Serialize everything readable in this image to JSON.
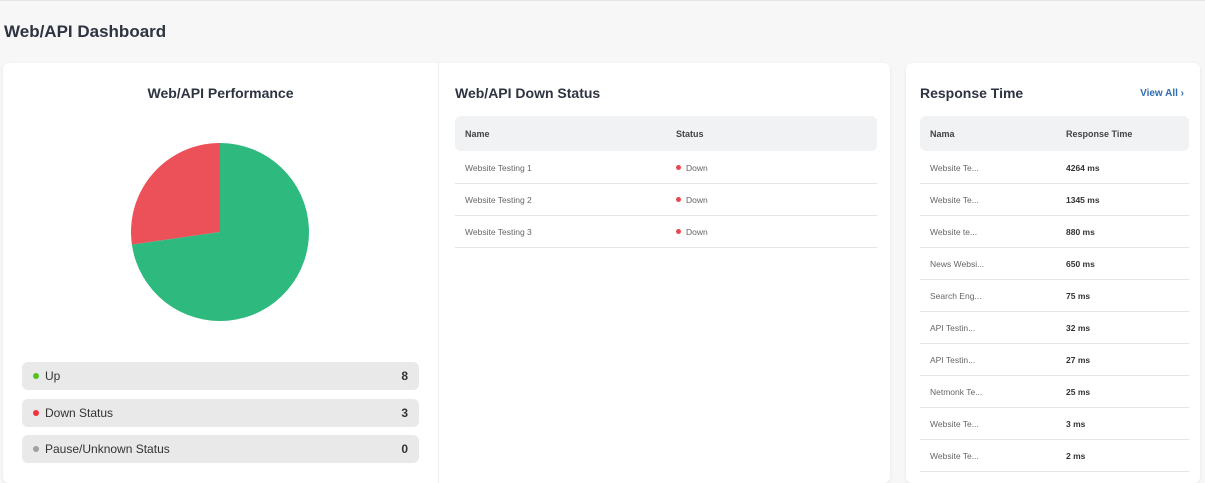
{
  "page_title": "Web/API Dashboard",
  "performance": {
    "title": "Web/API Performance",
    "colors": {
      "up": "#2eb97e",
      "down": "#ec5058"
    },
    "legend": [
      {
        "label": "Up",
        "value": "8",
        "color": "#52c41a"
      },
      {
        "label": "Down Status",
        "value": "3",
        "color": "#f5313f"
      },
      {
        "label": "Pause/Unknown Status",
        "value": "0",
        "color": "#a0a0a0"
      }
    ]
  },
  "down_status": {
    "title": "Web/API Down Status",
    "columns": [
      "Name",
      "Status"
    ],
    "rows": [
      {
        "name": "Website Testing 1",
        "status": "Down"
      },
      {
        "name": "Website Testing 2",
        "status": "Down"
      },
      {
        "name": "Website Testing 3",
        "status": "Down"
      }
    ]
  },
  "response": {
    "title": "Response Time",
    "view_all": "View All",
    "columns": [
      "Nama",
      "Response Time"
    ],
    "rows": [
      {
        "name": "Website Te...",
        "time": "4264 ms"
      },
      {
        "name": "Website Te...",
        "time": "1345 ms"
      },
      {
        "name": "Website te...",
        "time": "880 ms"
      },
      {
        "name": "News Websi...",
        "time": "650 ms"
      },
      {
        "name": "Search Eng...",
        "time": "75 ms"
      },
      {
        "name": "API Testin...",
        "time": "32 ms"
      },
      {
        "name": "API Testin...",
        "time": "27 ms"
      },
      {
        "name": "Netmonk Te...",
        "time": "25 ms"
      },
      {
        "name": "Website Te...",
        "time": "3 ms"
      },
      {
        "name": "Website Te...",
        "time": "2 ms"
      }
    ]
  }
}
